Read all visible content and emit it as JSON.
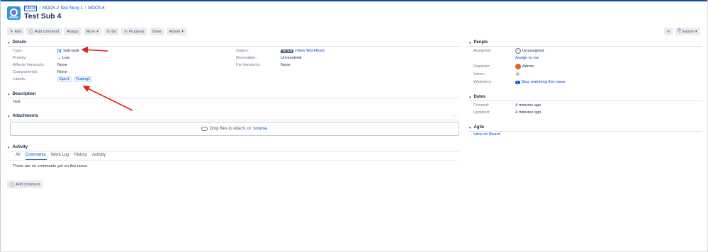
{
  "breadcrumb": {
    "project": "Mock",
    "parent": "MOCK-2 Test Story 1",
    "key": "MOCK-6"
  },
  "issue": {
    "title": "Test Sub 4"
  },
  "toolbar": {
    "edit": "Edit",
    "add_comment": "Add comment",
    "assign": "Assign",
    "more": "More",
    "to_do": "To Do",
    "in_progress": "In Progress",
    "done": "Done",
    "admin": "Admin",
    "export": "Export"
  },
  "details": {
    "heading": "Details",
    "type_label": "Type:",
    "type_value": "Sub-task",
    "priority_label": "Priority:",
    "priority_value": "Low",
    "affects_label": "Affects Version/s:",
    "affects_value": "None",
    "component_label": "Component/s:",
    "component_value": "None",
    "labels_label": "Labels:",
    "labels": [
      "Epic1",
      "Testing1"
    ],
    "status_label": "Status:",
    "status_value": "TO DO",
    "status_link": "(View Workflow)",
    "resolution_label": "Resolution:",
    "resolution_value": "Unresolved",
    "fix_label": "Fix Version/s:",
    "fix_value": "None"
  },
  "description": {
    "heading": "Description",
    "text": "Test"
  },
  "attachments": {
    "heading": "Attachments",
    "more": "···",
    "drop_text": "Drop files to attach, or",
    "browse": "browse."
  },
  "activity": {
    "heading": "Activity",
    "tabs": [
      "All",
      "Comments",
      "Work Log",
      "History",
      "Activity"
    ],
    "empty": "There are no comments yet on this issue.",
    "add_comment": "Add comment"
  },
  "people": {
    "heading": "People",
    "assignee_label": "Assignee:",
    "assignee_value": "Unassigned",
    "assign_me": "Assign to me",
    "reporter_label": "Reporter:",
    "reporter_value": "Admin",
    "votes_label": "Votes:",
    "votes_value": "0",
    "watchers_label": "Watchers:",
    "watchers_count": "1",
    "watchers_link": "Stop watching this issue"
  },
  "dates": {
    "heading": "Dates",
    "created_label": "Created:",
    "created_value": "4 minutes ago",
    "updated_label": "Updated:",
    "updated_value": "4 minutes ago"
  },
  "agile": {
    "heading": "Agile",
    "link": "View on Board"
  },
  "colors": {
    "link": "#0052cc",
    "annotation": "#e2231a",
    "brand": "#0c4f9d"
  }
}
